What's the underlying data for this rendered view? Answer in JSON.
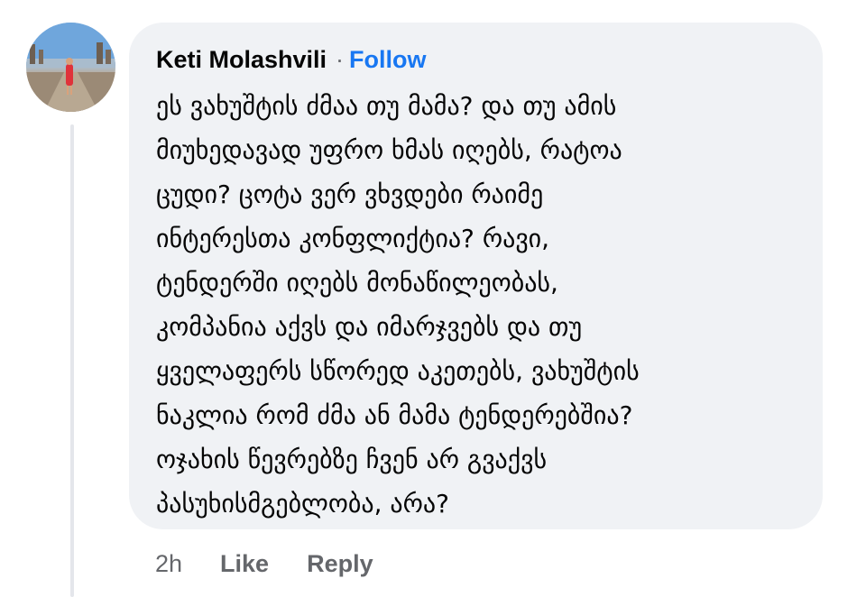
{
  "comment": {
    "author": "Keti Molashvili",
    "separator": "·",
    "follow_label": "Follow",
    "lines": [
      "ეს ვახუშტის ძმაა თუ მამა? და თუ ამის",
      "მიუხედავად უფრო ხმას იღებს, რატოა",
      "ცუდი? ცოტა ვერ ვხვდები რაიმე",
      "ინტერესთა კონფლიქტია? რავი,",
      "ტენდერში იღებს მონაწილეობას,",
      "კომპანია აქვს და იმარჯვებს და თუ",
      "ყველაფერს სწორედ აკეთებს, ვახუშტის",
      "ნაკლია რომ ძმა ან მამა ტენდერებშია?",
      "ოჯახის წევრებზე ჩვენ არ გვაქვს",
      "პასუხისმგებლობა, არა?"
    ]
  },
  "actions": {
    "time": "2h",
    "like_label": "Like",
    "reply_label": "Reply"
  },
  "colors": {
    "bubble": "#f0f2f5",
    "link": "#1877f2",
    "muted": "#65676b",
    "text": "#050505"
  }
}
